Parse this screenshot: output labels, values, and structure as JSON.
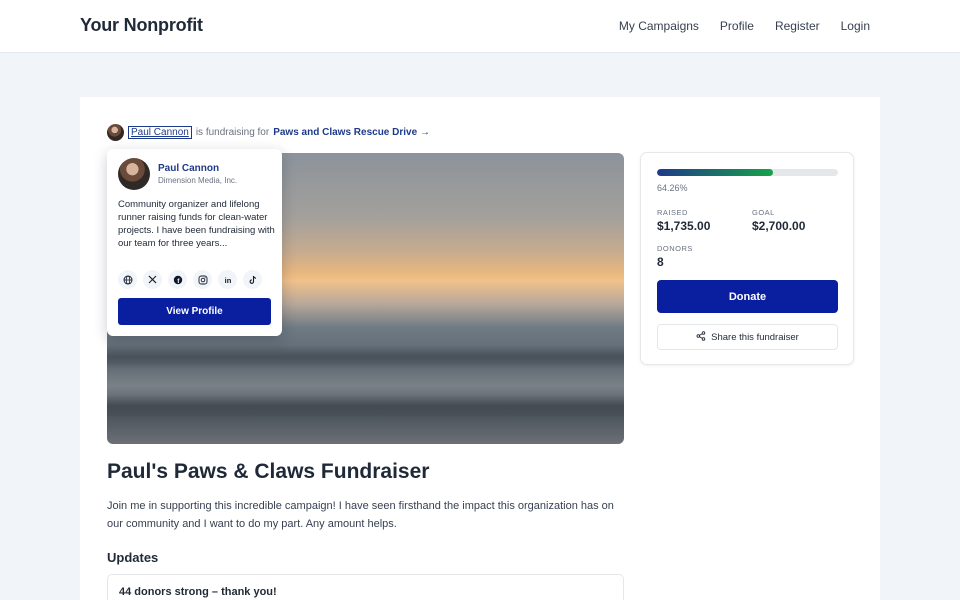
{
  "nav": {
    "brand": "Your Nonprofit",
    "links": [
      "My Campaigns",
      "Profile",
      "Register",
      "Login"
    ]
  },
  "byline": {
    "owner": "Paul Cannon",
    "middle": "is fundraising for",
    "campaign": "Paws and Claws Rescue Drive",
    "arrow": "→"
  },
  "profile_popover": {
    "name": "Paul Cannon",
    "org": "Dimension Media, Inc.",
    "bio": "Community organizer and lifelong runner raising funds for clean-water projects. I have been fundraising with our team for three years...",
    "social_icons": [
      "globe-icon",
      "x-icon",
      "facebook-icon",
      "instagram-icon",
      "linkedin-icon",
      "tiktok-icon"
    ],
    "button": "View Profile"
  },
  "campaign": {
    "title": "Paul's Paws & Claws Fundraiser",
    "description": "Join me in supporting this incredible campaign! I have seen firsthand the impact this organization has on our community and I want to do my part. Any amount helps.",
    "updates_heading": "Updates",
    "updates": [
      {
        "title": "44 donors strong – thank you!"
      }
    ]
  },
  "stats": {
    "progress_fraction": 0.6426,
    "percent_label": "64.26%",
    "raised_label": "RAISED",
    "raised_value": "$1,735.00",
    "goal_label": "GOAL",
    "goal_value": "$2,700.00",
    "donors_label": "DONORS",
    "donors_value": "8",
    "donate_button": "Donate",
    "share_button": "Share this fundraiser"
  },
  "colors": {
    "primary": "#0a1ea0",
    "link": "#1e3a8a",
    "progress_start": "#1e3a8a",
    "progress_end": "#16a34a"
  }
}
